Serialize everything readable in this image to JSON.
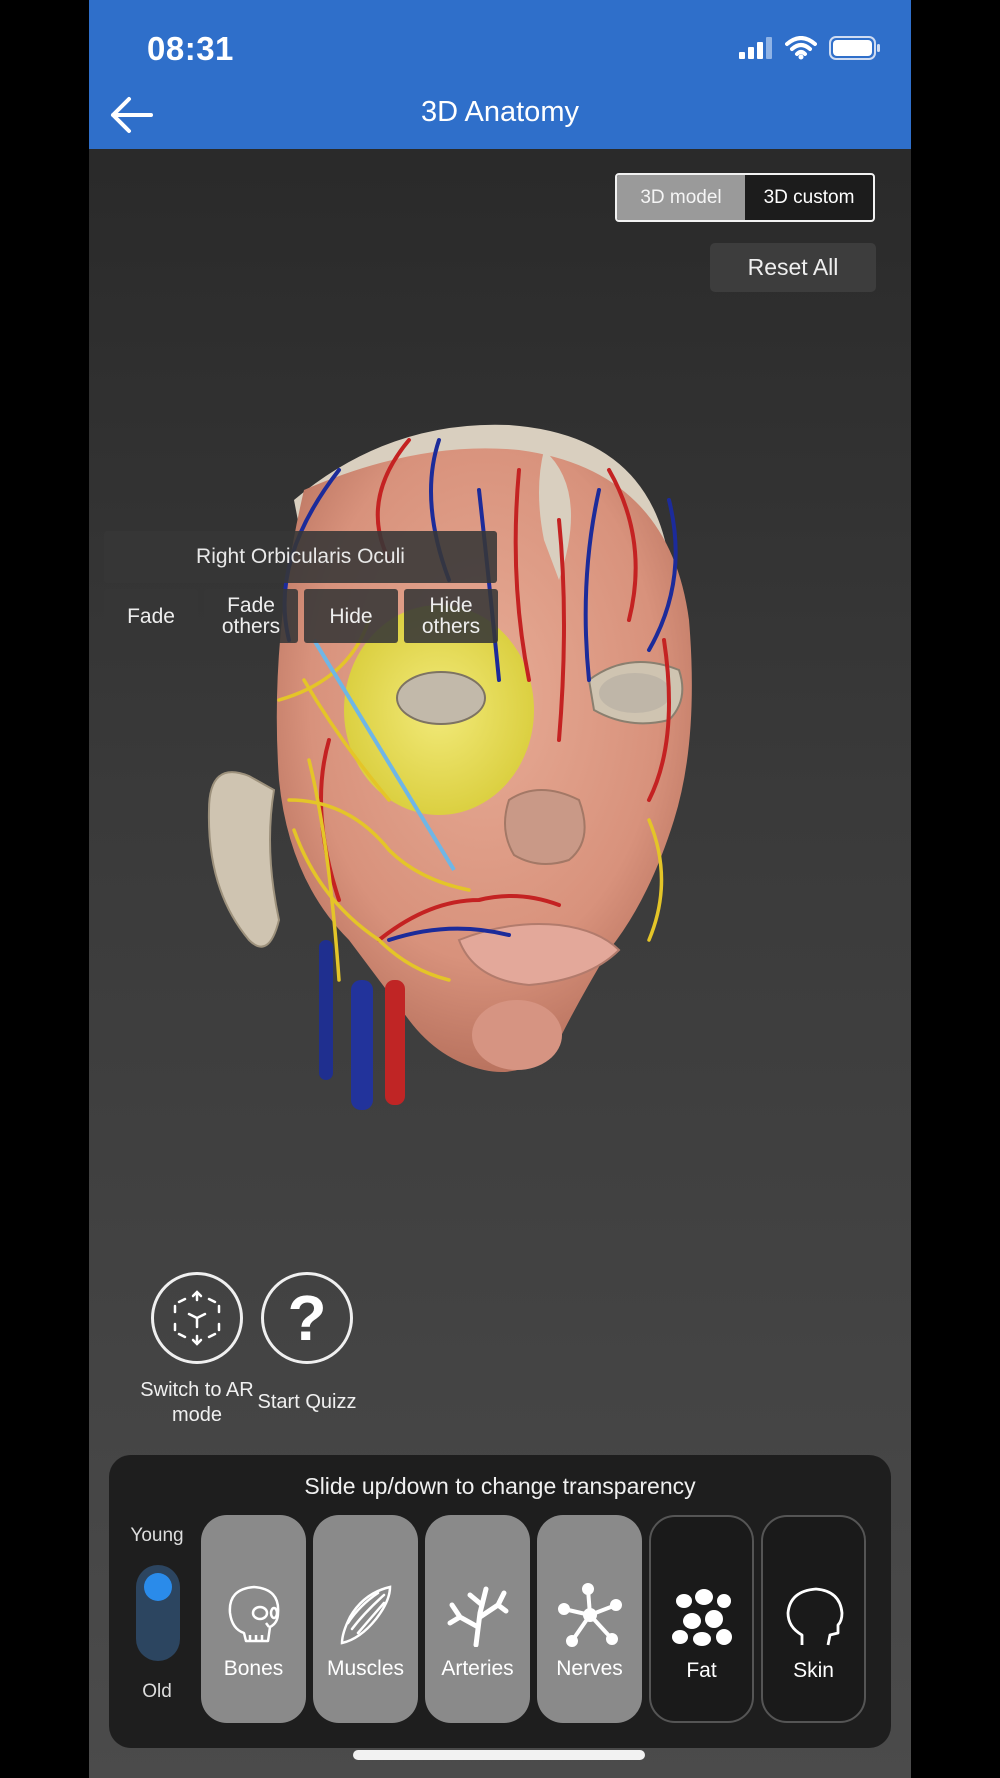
{
  "status_bar": {
    "time": "08:31"
  },
  "header": {
    "title": "3D Anatomy"
  },
  "view_toggle": {
    "options": [
      "3D model",
      "3D custom"
    ],
    "selected": "3D model"
  },
  "reset_label": "Reset All",
  "selection": {
    "structure_name": "Right Orbicularis Oculi",
    "actions": [
      "Fade",
      "Fade others",
      "Hide",
      "Hide others"
    ]
  },
  "actions": {
    "ar_mode": "Switch to AR mode",
    "quiz": "Start Quizz"
  },
  "panel": {
    "hint": "Slide up/down to change transparency",
    "age_top": "Young",
    "age_bottom": "Old",
    "layers": [
      {
        "label": "Bones",
        "icon": "skull-icon",
        "active": true
      },
      {
        "label": "Muscles",
        "icon": "muscle-icon",
        "active": true
      },
      {
        "label": "Arteries",
        "icon": "artery-icon",
        "active": true
      },
      {
        "label": "Nerves",
        "icon": "nerve-icon",
        "active": true
      },
      {
        "label": "Fat",
        "icon": "fat-icon",
        "active": false
      },
      {
        "label": "Skin",
        "icon": "skin-icon",
        "active": false
      }
    ]
  },
  "colors": {
    "header_bg": "#2f6fca",
    "highlight": "#e6dd4a",
    "age_knob": "#2a8bea"
  }
}
